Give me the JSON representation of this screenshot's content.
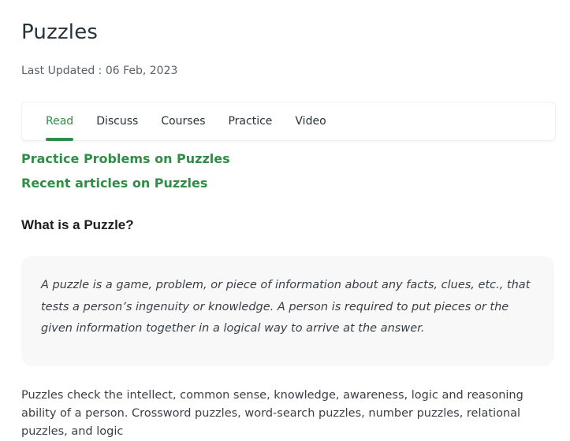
{
  "article": {
    "title": "Puzzles",
    "last_updated": "Last Updated : 06 Feb, 2023"
  },
  "tabs": [
    {
      "label": "Read",
      "active": true
    },
    {
      "label": "Discuss",
      "active": false
    },
    {
      "label": "Courses",
      "active": false
    },
    {
      "label": "Practice",
      "active": false
    },
    {
      "label": "Video",
      "active": false
    }
  ],
  "links": {
    "practice_problems": "Practice Problems on Puzzles",
    "recent_articles": "Recent articles on Puzzles"
  },
  "section": {
    "heading": "What is a Puzzle?",
    "quote": "A puzzle is a game, problem, or piece of information about any facts, clues, etc., that tests a person’s ingenuity or knowledge. A person is required to put pieces or the given information together in a logical way to arrive at the answer.",
    "body": "Puzzles check the intellect, common sense, knowledge, awareness, logic and reasoning ability of a person. Crossword puzzles, word-search puzzles, number puzzles, relational puzzles, and logic"
  },
  "colors": {
    "accent": "#2f8d46",
    "text": "#273239",
    "quote_bg": "#f8f8f8"
  }
}
